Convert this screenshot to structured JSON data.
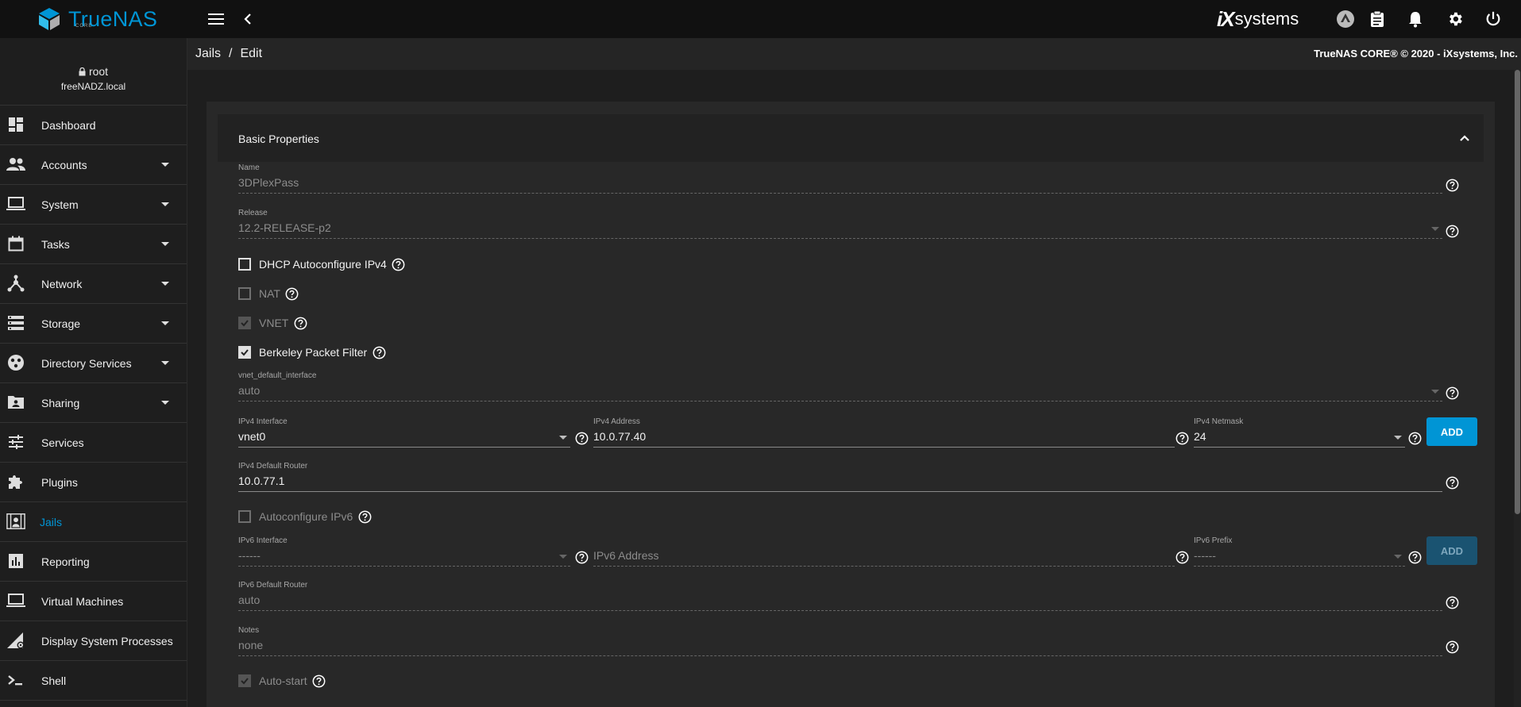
{
  "app": {
    "logo_text": "TrueNAS",
    "logo_sub": "CORE",
    "vendor_logo_ix": "iX",
    "vendor_logo_systems": "systems",
    "copyright": "TrueNAS CORE® © 2020 - iXsystems, Inc."
  },
  "user": {
    "name": "root",
    "host": "freeNADZ.local"
  },
  "sidebar": {
    "items": [
      {
        "label": "Dashboard",
        "icon": "dashboard-icon",
        "expandable": false
      },
      {
        "label": "Accounts",
        "icon": "people-icon",
        "expandable": true
      },
      {
        "label": "System",
        "icon": "laptop-icon",
        "expandable": true
      },
      {
        "label": "Tasks",
        "icon": "calendar-icon",
        "expandable": true
      },
      {
        "label": "Network",
        "icon": "network-icon",
        "expandable": true
      },
      {
        "label": "Storage",
        "icon": "storage-icon",
        "expandable": true
      },
      {
        "label": "Directory Services",
        "icon": "directory-icon",
        "expandable": true
      },
      {
        "label": "Sharing",
        "icon": "shared-folder-icon",
        "expandable": true
      },
      {
        "label": "Services",
        "icon": "tune-icon",
        "expandable": false
      },
      {
        "label": "Plugins",
        "icon": "puzzle-icon",
        "expandable": false
      },
      {
        "label": "Jails",
        "icon": "jail-icon",
        "expandable": false,
        "active": true
      },
      {
        "label": "Reporting",
        "icon": "chart-icon",
        "expandable": false
      },
      {
        "label": "Virtual Machines",
        "icon": "laptop-icon",
        "expandable": false
      },
      {
        "label": "Display System Processes",
        "icon": "processes-icon",
        "expandable": false
      },
      {
        "label": "Shell",
        "icon": "shell-icon",
        "expandable": false
      }
    ]
  },
  "breadcrumb": {
    "parent": "Jails",
    "separator": "/",
    "current": "Edit"
  },
  "section": {
    "title": "Basic Properties"
  },
  "form": {
    "name": {
      "label": "Name",
      "value": "3DPlexPass"
    },
    "release": {
      "label": "Release",
      "value": "12.2-RELEASE-p2"
    },
    "dhcp": {
      "label": "DHCP Autoconfigure IPv4",
      "checked": false
    },
    "nat": {
      "label": "NAT",
      "checked": false
    },
    "vnet": {
      "label": "VNET",
      "checked": true
    },
    "bpf": {
      "label": "Berkeley Packet Filter",
      "checked": true
    },
    "vnet_default_interface": {
      "label": "vnet_default_interface",
      "value": "auto"
    },
    "ipv4_interface": {
      "label": "IPv4 Interface",
      "value": "vnet0"
    },
    "ipv4_address": {
      "label": "IPv4 Address",
      "value": "10.0.77.40"
    },
    "ipv4_netmask": {
      "label": "IPv4 Netmask",
      "value": "24"
    },
    "ipv4_add_label": "ADD",
    "ipv4_default_router": {
      "label": "IPv4 Default Router",
      "value": "10.0.77.1"
    },
    "autoconf_ipv6": {
      "label": "Autoconfigure IPv6",
      "checked": false
    },
    "ipv6_interface": {
      "label": "IPv6 Interface",
      "value": "------"
    },
    "ipv6_address": {
      "placeholder": "IPv6 Address"
    },
    "ipv6_prefix": {
      "label": "IPv6 Prefix",
      "value": "------"
    },
    "ipv6_add_label": "ADD",
    "ipv6_default_router": {
      "label": "IPv6 Default Router",
      "value": "auto"
    },
    "notes": {
      "label": "Notes",
      "value": "none"
    },
    "autostart": {
      "label": "Auto-start",
      "checked": true
    }
  },
  "colors": {
    "accent": "#0095d5",
    "topbar": "#111111",
    "panel": "#282828"
  }
}
